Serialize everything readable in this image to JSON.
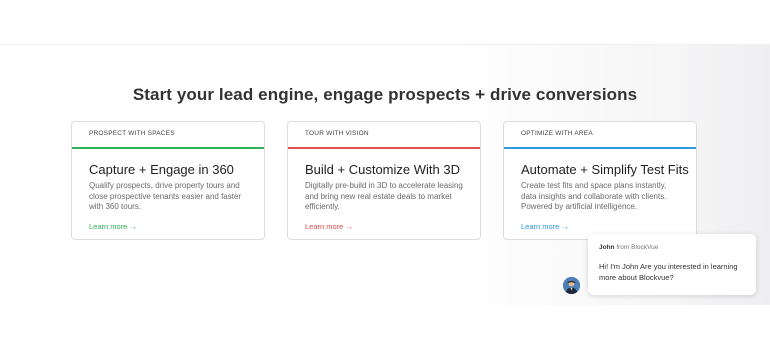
{
  "headline": "Start your lead engine, engage prospects + drive conversions",
  "cards": [
    {
      "tag": "PROSPECT WITH SPACES",
      "title": "Capture + Engage in 360",
      "description": "Qualify prospects, drive property tours and close prospective tenants easier and faster with 360 tours.",
      "link": "Learn more →",
      "accent": "#2eb35a"
    },
    {
      "tag": "TOUR WITH VISION",
      "title": "Build + Customize With 3D",
      "description": "Digitally pre-build in 3D to accelerate leasing and bring new real estate deals to market efficiently.",
      "link": "Learn more →",
      "accent": "#e04e4e"
    },
    {
      "tag": "OPTIMIZE WITH AREA",
      "title": "Automate + Simplify Test Fits",
      "description": "Create test fits and space plans instantly, data insights and collaborate with clients. Powered by artificial intelligence.",
      "link": "Learn more →",
      "accent": "#2d98e0"
    }
  ],
  "chat": {
    "sender_name": "John",
    "sender_suffix": " from BlockVue",
    "message": "Hi! I'm John Are you interested in learning more about Blockvue?",
    "avatar_icon": "person-avatar-icon"
  }
}
